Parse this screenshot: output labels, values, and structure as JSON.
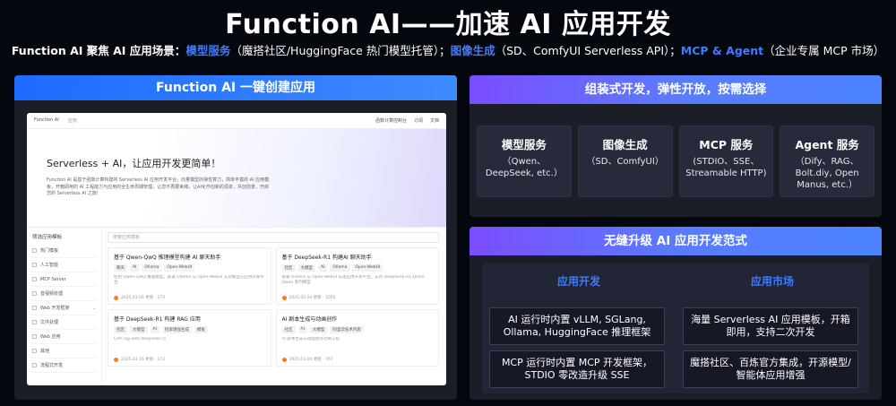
{
  "title": "Function AI——加速 AI 应用开发",
  "subtitle": {
    "prefix": "Function AI 聚焦 AI 应用场景：",
    "hl1": "模型服务",
    "p1": "（魔搭社区/HuggingFace 热门模型托管）；",
    "hl2": "图像生成",
    "p2": "（SD、ComfyUI Serverless API）；",
    "hl3": "MCP & Agent",
    "p3": "（企业专属 MCP 市场）"
  },
  "left": {
    "header": "Function AI 一键创建应用",
    "screen": {
      "brand": "Function AI",
      "brand_sub": "应用",
      "top_links": [
        "函数计算控制台",
        "订阅",
        "文档"
      ],
      "hero_title": "Serverless + AI，让应用开发更简单！",
      "hero_desc": "Function AI 是基于函数计算构建的 Serverless AI 应用开发平台，向量模型的弹性算力，简单丰富的 AI 应用模板，开箱即用的 AI 工程能力与应用的全生命周期管理，让您不再要束缚，让AI化作创新的源泉，共创前景，开启您的 Serverless AI 之旅!",
      "side_header": "筛选应用模板",
      "side_items": [
        "热门模板",
        "人工智能",
        "MCP Server",
        "音视频处理",
        "Web 开发框架",
        "文件处理",
        "Web 应用",
        "其他",
        "流程式开发"
      ],
      "search_placeholder": "搜索应用模板",
      "cards": [
        {
          "title": "基于 Qwen-QwQ 推理模型构建 AI 聊天助手",
          "tags": [
            "聊天",
            "AI",
            "Ollama",
            "Open-WebUI"
          ],
          "desc": "使用 Qwen-QwQ 推理模型，部署 Ollama 与 Open-WebUI 实现模型在应用开发平台",
          "meta": "2025.03.06 更新 · 173"
        },
        {
          "title": "基于 DeepSeek-R1 构建AI 聊天助手",
          "tags": [
            "社区",
            "大模型",
            "AI",
            "Ollama",
            "Open-WebUI"
          ],
          "desc": "部署 Ollama 与 Open-WebUI 实现应用开发平台，支持 DeepSeek-R1-Distill-Qwen 系列模型",
          "meta": "2025.02.04 更新 · 1050"
        },
        {
          "title": "基于 DeepSeek-R1 构建 RAG 应用",
          "tags": [
            "社区",
            "大模型",
            "AI",
            "检索增强生成",
            "模板"
          ],
          "desc": "CAP rag with deepseek-r1",
          "meta": "2025.03.16 更新 · 173"
        },
        {
          "title": "AI 剧本生成与动画创作",
          "tags": [
            "社区",
            "AI",
            "大模型",
            "阿里云技术内容"
          ],
          "desc": "AI 剧本生成与动画创作示例工程",
          "meta": "2025.03.04 更新 · 767"
        }
      ]
    }
  },
  "right_top": {
    "header": "组装式开发，弹性开放，按需选择",
    "items": [
      {
        "title": "模型服务",
        "desc": "（Qwen、DeepSeek, etc.）"
      },
      {
        "title": "图像生成",
        "desc": "（SD、ComfyUI）"
      },
      {
        "title": "MCP 服务",
        "desc": "(STDIO、SSE、Streamable HTTP)"
      },
      {
        "title": "Agent 服务",
        "desc": "（Dify、RAG、Bolt.diy, Open Manus, etc.）"
      }
    ]
  },
  "right_bottom": {
    "header": "无缝升级 AI 应用开发范式",
    "col1_title": "应用开发",
    "col2_title": "应用市场",
    "boxes": [
      "AI 运行时内置 vLLM, SGLang, Ollama, HuggingFace 推理框架",
      "海量 Serverless AI 应用模板，开箱即用，支持二次开发",
      "MCP 运行时内置 MCP 开发框架，STDIO 零改造升级 SSE",
      "魔搭社区、百炼官方集成，开源模型/智能体应用增强"
    ]
  }
}
